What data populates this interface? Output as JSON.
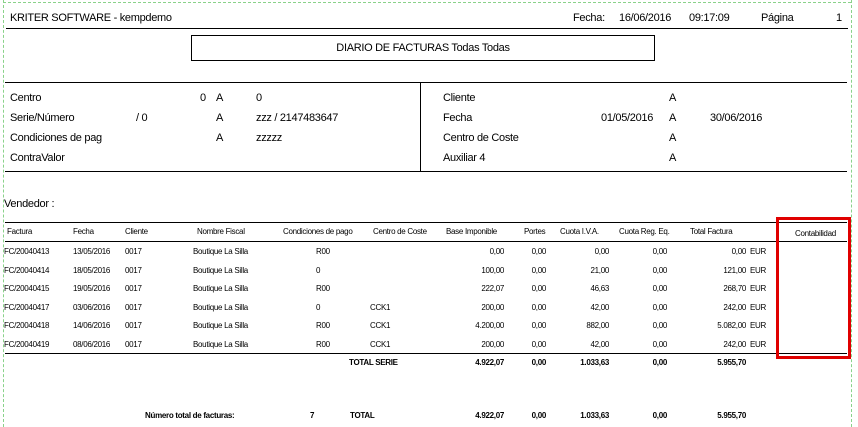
{
  "header": {
    "company": "KRITER SOFTWARE - kempdemo",
    "fecha_label": "Fecha:",
    "fecha_value": "16/06/2016",
    "time": "09:17:09",
    "pagina_label": "Página",
    "pagina_value": "1"
  },
  "report_title": "DIARIO DE FACTURAS  Todas  Todas",
  "filters_left": [
    {
      "label": "Centro",
      "a1": "",
      "sep": "0",
      "a": "A",
      "to": "0"
    },
    {
      "label": "Serie/Número",
      "a1": "/ 0",
      "sep": "",
      "a": "A",
      "to": "zzz  / 2147483647"
    },
    {
      "label": "Condiciones de pag",
      "a1": "",
      "sep": "",
      "a": "A",
      "to": "zzzzz"
    },
    {
      "label": "ContraValor",
      "a1": "",
      "sep": "",
      "a": "",
      "to": ""
    }
  ],
  "filters_right": [
    {
      "label": "Cliente",
      "from": "",
      "a": "A",
      "to": ""
    },
    {
      "label": "Fecha",
      "from": "01/05/2016",
      "a": "A",
      "to": "30/06/2016"
    },
    {
      "label": "Centro de Coste",
      "from": "",
      "a": "A",
      "to": ""
    },
    {
      "label": "Auxiliar 4",
      "from": "",
      "a": "A",
      "to": ""
    }
  ],
  "vendedor_label": "Vendedor :",
  "columns": [
    "Factura",
    "Fecha",
    "Cliente",
    "Nombre Fiscal",
    "Condiciones de pago",
    "Centro de Coste",
    "Base Imponible",
    "Portes",
    "Cuota I.V.A.",
    "Cuota Reg. Eq.",
    "Total Factura",
    "Contabilidad"
  ],
  "rows": [
    [
      "FC/20040413",
      "13/05/2016",
      "0017",
      "Boutique La Silla",
      "R00",
      "",
      "0,00",
      "0,00",
      "0,00",
      "0,00",
      "0,00",
      "EUR"
    ],
    [
      "FC/20040414",
      "18/05/2016",
      "0017",
      "Boutique La Silla",
      "0",
      "",
      "100,00",
      "0,00",
      "21,00",
      "0,00",
      "121,00",
      "EUR"
    ],
    [
      "FC/20040415",
      "19/05/2016",
      "0017",
      "Boutique La Silla",
      "R00",
      "",
      "222,07",
      "0,00",
      "46,63",
      "0,00",
      "268,70",
      "EUR"
    ],
    [
      "FC/20040417",
      "03/06/2016",
      "0017",
      "Boutique La Silla",
      "0",
      "CCK1",
      "200,00",
      "0,00",
      "42,00",
      "0,00",
      "242,00",
      "EUR"
    ],
    [
      "FC/20040418",
      "14/06/2016",
      "0017",
      "Boutique La Silla",
      "R00",
      "CCK1",
      "4.200,00",
      "0,00",
      "882,00",
      "0,00",
      "5.082,00",
      "EUR"
    ],
    [
      "FC/20040419",
      "08/06/2016",
      "0017",
      "Boutique La Silla",
      "R00",
      "CCK1",
      "200,00",
      "0,00",
      "42,00",
      "0,00",
      "242,00",
      "EUR"
    ]
  ],
  "total_serie": {
    "label": "TOTAL SERIE",
    "base": "4.922,07",
    "portes": "0,00",
    "iva": "1.033,63",
    "req": "0,00",
    "total": "5.955,70"
  },
  "grand_total": {
    "count_label": "Número total de facturas:",
    "count": "7",
    "label": "TOTAL",
    "base": "4.922,07",
    "portes": "0,00",
    "iva": "1.033,63",
    "req": "0,00",
    "total": "5.955,70"
  },
  "colors": {
    "highlight": "#e00000",
    "page_border": "#8ad28a"
  }
}
